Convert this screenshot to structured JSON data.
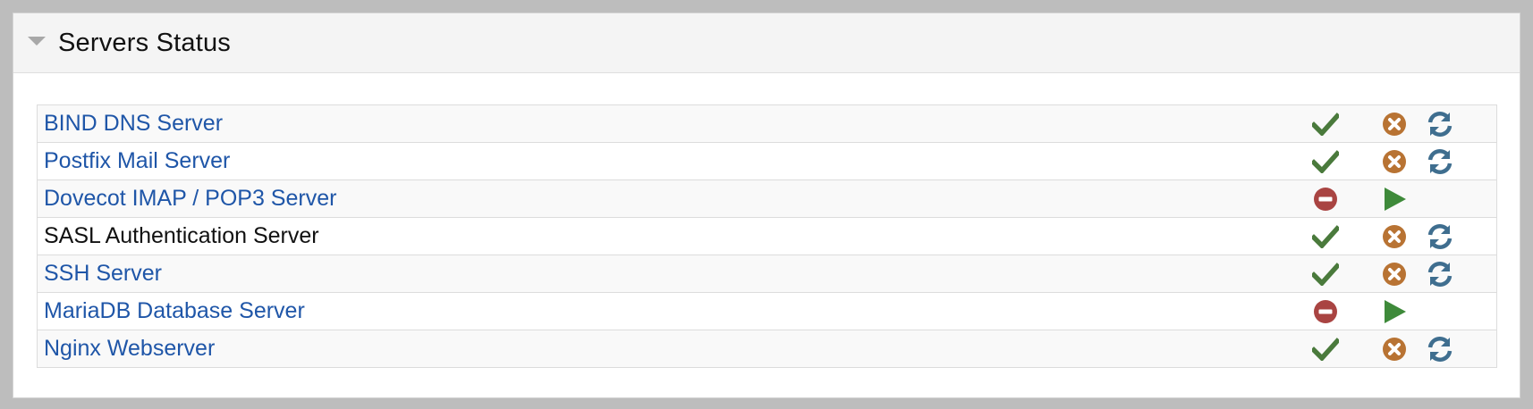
{
  "panel": {
    "title": "Servers Status"
  },
  "servers": [
    {
      "name": "BIND DNS Server",
      "linked": true,
      "running": true
    },
    {
      "name": "Postfix Mail Server",
      "linked": true,
      "running": true
    },
    {
      "name": "Dovecot IMAP / POP3 Server",
      "linked": true,
      "running": false
    },
    {
      "name": "SASL Authentication Server",
      "linked": false,
      "running": true
    },
    {
      "name": "SSH Server",
      "linked": true,
      "running": true
    },
    {
      "name": "MariaDB Database Server",
      "linked": true,
      "running": false
    },
    {
      "name": "Nginx Webserver",
      "linked": true,
      "running": true
    }
  ],
  "icons": {
    "running": "check-icon",
    "stopped": "stopped-icon",
    "stop": "stop-icon",
    "restart": "restart-icon",
    "start": "start-icon"
  },
  "colors": {
    "link": "#1f56a8",
    "check": "#4a7a3c",
    "stopped": "#a94442",
    "stop": "#b87333",
    "restart": "#3f6e8f",
    "start": "#3e8a3a"
  }
}
